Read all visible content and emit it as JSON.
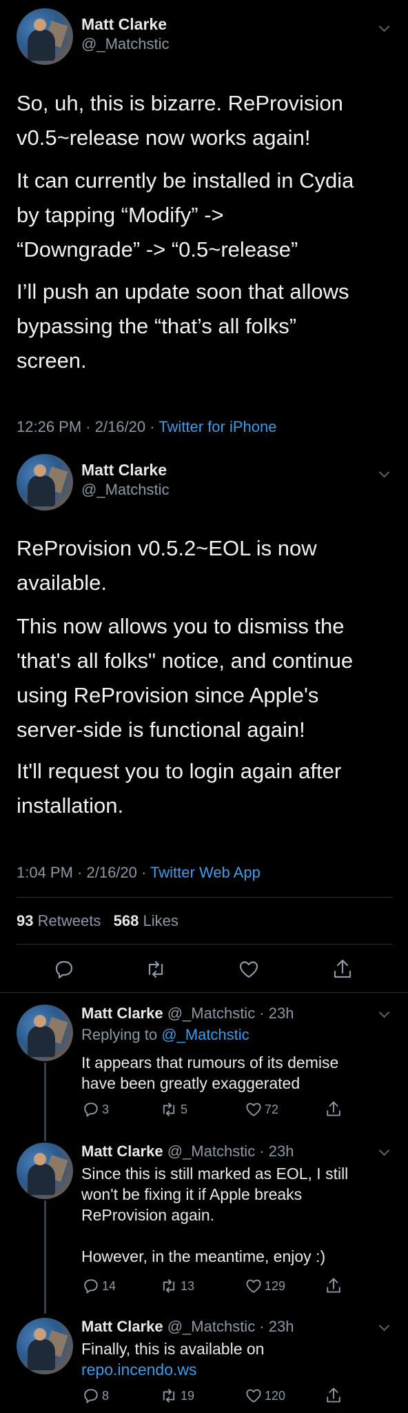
{
  "tweet1": {
    "name": "Matt Clarke",
    "handle": "@_Matchstic",
    "p1": [
      "So, uh, this is bizarre. ReProvision",
      "v0.5~release now works again!"
    ],
    "p2": [
      "It can currently be installed in Cydia",
      "by tapping “Modify” ->",
      "“Downgrade” -> “0.5~release”"
    ],
    "p3": [
      "I’ll push an update soon that allows",
      "bypassing the “that’s all folks”",
      "screen."
    ],
    "time": "12:26 PM · 2/16/20 · ",
    "source": "Twitter for iPhone"
  },
  "tweet2": {
    "name": "Matt Clarke",
    "handle": "@_Matchstic",
    "p1": [
      "ReProvision v0.5.2~EOL is now",
      "available."
    ],
    "p2": [
      "This now allows you to dismiss the",
      "'that's all folks\" notice, and continue",
      "using ReProvision since Apple's",
      "server-side is functional again!"
    ],
    "p3": [
      "It'll request you to login again after",
      "installation."
    ],
    "time": "1:04 PM · 2/16/20 · ",
    "source": "Twitter Web App",
    "retweets_count": "93",
    "retweets_label": "Retweets",
    "likes_count": "568",
    "likes_label": "Likes"
  },
  "replies": [
    {
      "name": "Matt Clarke",
      "handle_time": "@_Matchstic · 23h",
      "replying_prefix": "Replying to ",
      "replying_handle": "@_Matchstic",
      "lines": [
        "It appears that rumours of its demise",
        "have been greatly exaggerated"
      ],
      "replies": "3",
      "retweets": "5",
      "likes": "72"
    },
    {
      "name": "Matt Clarke",
      "handle_time": "@_Matchstic · 23h",
      "lines": [
        "Since this is still marked as EOL, I still",
        "won't be fixing it if Apple breaks",
        "ReProvision again.",
        "",
        "However, in the meantime, enjoy :)"
      ],
      "replies": "14",
      "retweets": "13",
      "likes": "129"
    },
    {
      "name": "Matt Clarke",
      "handle_time": "@_Matchstic · 23h",
      "lines": [
        "Finally, this is available on"
      ],
      "link": "repo.incendo.ws",
      "replies": "8",
      "retweets": "19",
      "likes": "120"
    }
  ]
}
